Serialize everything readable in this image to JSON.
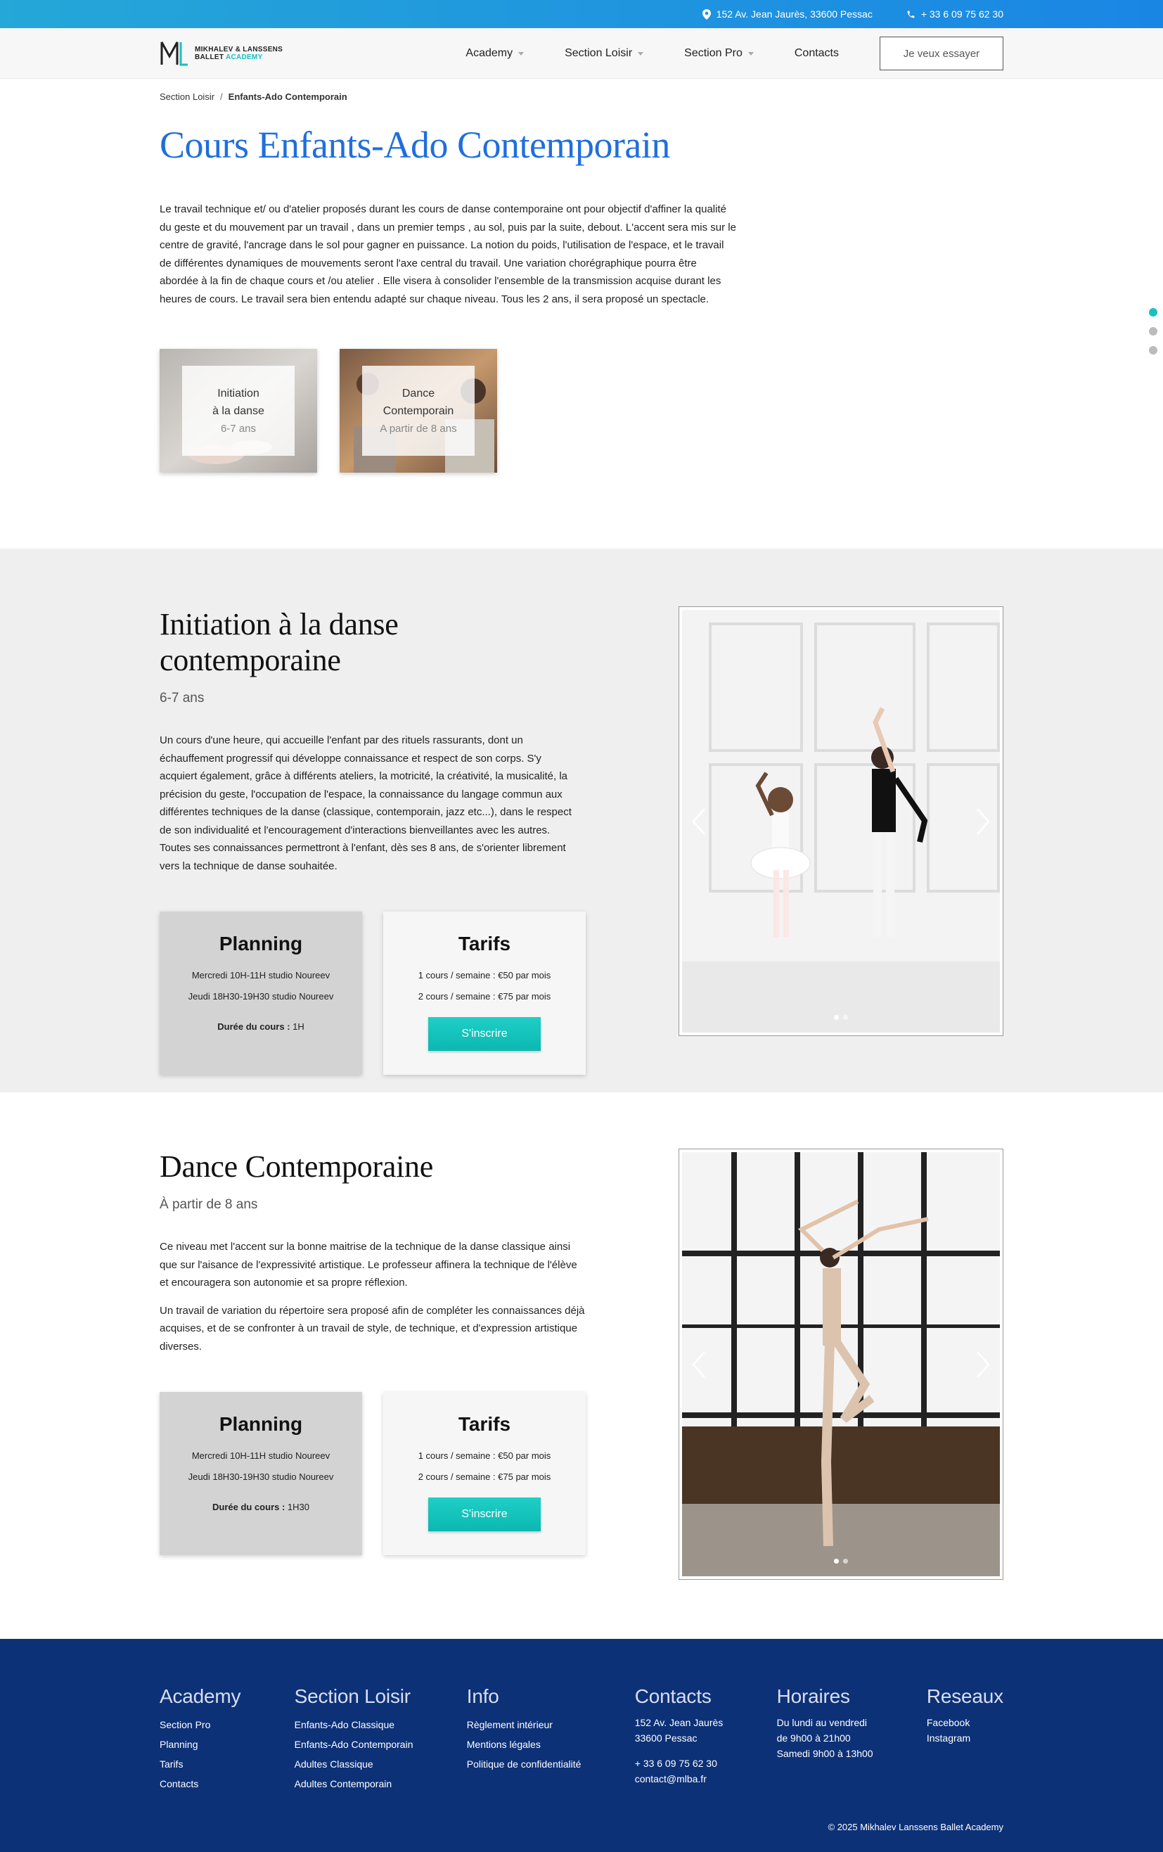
{
  "topbar": {
    "address": "152 Av. Jean Jaurès, 33600 Pessac",
    "phone": "+ 33 6 09 75 62 30"
  },
  "header": {
    "logo_line1": "MIKHALEV & LANSSENS",
    "logo_line2a": "BALLET",
    "logo_line2b": "ACADEMY",
    "nav": [
      {
        "label": "Academy",
        "dropdown": true
      },
      {
        "label": "Section Loisir",
        "dropdown": true
      },
      {
        "label": "Section Pro",
        "dropdown": true
      },
      {
        "label": "Contacts",
        "dropdown": false
      }
    ],
    "cta": "Je veux essayer"
  },
  "breadcrumb": {
    "parent": "Section Loisir",
    "separator": "/",
    "current": "Enfants-Ado Contemporain"
  },
  "intro": {
    "title": "Cours Enfants-Ado Contemporain",
    "text": "Le travail technique et/ ou d'atelier proposés durant les cours de danse contemporaine ont pour objectif d'affiner la qualité du geste et du mouvement par un travail , dans un premier temps , au sol, puis par la suite, debout. L'accent sera mis sur le centre de gravité, l'ancrage dans le sol pour gagner en puissance. La notion du poids, l'utilisation de l'espace, et le travail de différentes dynamiques de mouvements seront l'axe central du travail. Une variation chorégraphique pourra être abordée à la fin de chaque cours et /ou atelier . Elle visera à consolider l'ensemble de la transmission acquise durant les heures de cours. Le travail sera bien entendu adapté sur chaque niveau. Tous les 2 ans, il sera proposé un spectacle.",
    "cards": [
      {
        "line1": "Initiation",
        "line2": "à la danse",
        "age": "6-7 ans"
      },
      {
        "line1": "Dance",
        "line2": "Contemporain",
        "age": "A partir de 8 ans"
      }
    ]
  },
  "section1": {
    "title": "Initiation à la danse contemporaine",
    "subtitle": "6-7 ans",
    "paragraphs": [
      "Un cours d'une heure, qui accueille l'enfant par des rituels rassurants, dont un échauffement progressif qui développe connaissance et respect de son corps. S'y acquiert également, grâce à différents ateliers, la motricité, la créativité, la musicalité, la précision du geste, l'occupation de l'espace, la connaissance du langage commun aux différentes techniques de la danse (classique, contemporain, jazz etc...), dans le respect de son individualité et l'encouragement d'interactions bienveillantes avec les autres. Toutes ses connaissances permettront à l'enfant, dès ses 8 ans, de s'orienter librement vers la technique de danse souhaitée."
    ],
    "planning": {
      "title": "Planning",
      "lines": [
        "Mercredi 10H-11H studio Noureev",
        "Jeudi 18H30-19H30 studio Noureev"
      ],
      "duration_label": "Durée du cours :",
      "duration_value": " 1H"
    },
    "tarifs": {
      "title": "Tarifs",
      "lines": [
        "1 cours / semaine : €50 par mois",
        "2 cours / semaine : €75 par mois"
      ],
      "button": "S'inscrire"
    }
  },
  "section2": {
    "title": "Dance Contemporaine",
    "subtitle": "À partir de 8 ans",
    "paragraphs": [
      "Ce niveau met l'accent sur la bonne maitrise de la technique de la danse classique ainsi que sur l'aisance de l'expressivité artistique. Le professeur affinera la technique de l'élève et encouragera son autonomie et sa propre réflexion.",
      "Un travail de variation du répertoire sera proposé afin de compléter les connaissances déjà acquises, et de se confronter à un travail de style, de technique, et d'expression artistique diverses."
    ],
    "planning": {
      "title": "Planning",
      "lines": [
        "Mercredi 10H-11H studio Noureev",
        "Jeudi 18H30-19H30 studio Noureev"
      ],
      "duration_label": "Durée du cours :",
      "duration_value": " 1H30"
    },
    "tarifs": {
      "title": "Tarifs",
      "lines": [
        "1 cours / semaine : €50 par mois",
        "2 cours / semaine : €75 par mois"
      ],
      "button": "S'inscrire"
    }
  },
  "footer": {
    "academy": {
      "title": "Academy",
      "links": [
        "Section Pro",
        "Planning",
        "Tarifs",
        "Contacts"
      ]
    },
    "loisir": {
      "title": "Section Loisir",
      "links": [
        "Enfants-Ado Classique",
        "Enfants-Ado Contemporain",
        "Adultes Classique",
        "Adultes Contemporain"
      ]
    },
    "info": {
      "title": "Info",
      "links": [
        "Règlement intérieur",
        "Mentions légales",
        "Politique de confidentialité"
      ]
    },
    "contacts": {
      "title": "Contacts",
      "address1": "152 Av. Jean Jaurès",
      "address2": "33600 Pessac",
      "phone": "+ 33 6 09 75 62 30",
      "email": "contact@mlba.fr"
    },
    "horaires": {
      "title": "Horaires",
      "line1": "Du lundi au vendredi",
      "line2": "de 9h00 à 21h00",
      "line3": "Samedi 9h00 à 13h00"
    },
    "reseaux": {
      "title": "Reseaux",
      "links": [
        "Facebook",
        "Instagram"
      ]
    },
    "copyright": "© 2025 Mikhalev Lanssens Ballet Academy"
  },
  "colors": {
    "accent_blue": "#1f6fdc",
    "teal": "#1bbfc1",
    "footer_bg": "#0d3177"
  }
}
